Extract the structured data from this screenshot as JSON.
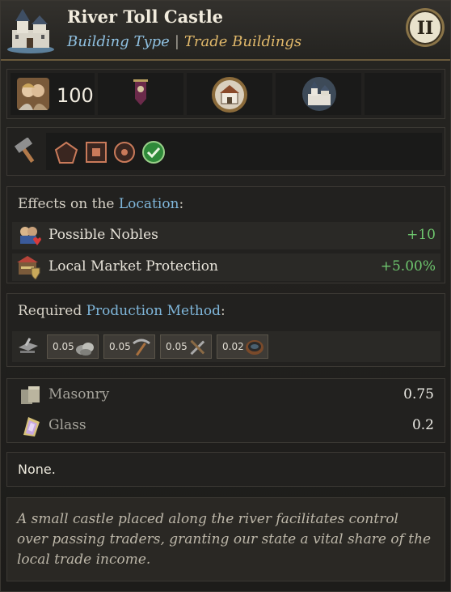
{
  "header": {
    "title": "River Toll Castle",
    "type_key": "Building Type",
    "separator": "|",
    "type_value": "Trade Buildings",
    "level": "II"
  },
  "stats": {
    "population": "100",
    "icons": [
      "nobles-portrait-icon",
      "banner-icon",
      "estate-building-icon",
      "castle-building-icon"
    ]
  },
  "tags": {
    "icons": [
      "hammer-icon",
      "pentagon-slot-icon",
      "square-slot-icon",
      "circle-slot-icon",
      "check-icon"
    ]
  },
  "effects": {
    "title_prefix": "Effects on the ",
    "title_link": "Location",
    "title_suffix": ":",
    "rows": [
      {
        "label": "Possible Nobles",
        "value": "+10",
        "icon": "nobles-heart-icon"
      },
      {
        "label": "Local Market Protection",
        "value": "+5.00%",
        "icon": "market-shield-icon"
      }
    ]
  },
  "production": {
    "title_prefix": "Required ",
    "title_link": "Production Method",
    "title_suffix": ":",
    "inputs": [
      {
        "qty": "0.05",
        "icon": "stone-icon"
      },
      {
        "qty": "0.05",
        "icon": "pickaxe-icon"
      },
      {
        "qty": "0.05",
        "icon": "crossed-tools-icon"
      },
      {
        "qty": "0.02",
        "icon": "bowl-icon"
      }
    ]
  },
  "materials": [
    {
      "label": "Masonry",
      "value": "0.75",
      "icon": "masonry-icon"
    },
    {
      "label": "Glass",
      "value": "0.2",
      "icon": "glass-icon"
    }
  ],
  "none_text": "None.",
  "description": "A small castle placed along the river facilitates control over passing traders, granting our state a vital share of the local trade income.",
  "colors": {
    "accent_blue": "#7fb6da",
    "accent_gold": "#e0b86a",
    "positive_green": "#6ec66e"
  }
}
